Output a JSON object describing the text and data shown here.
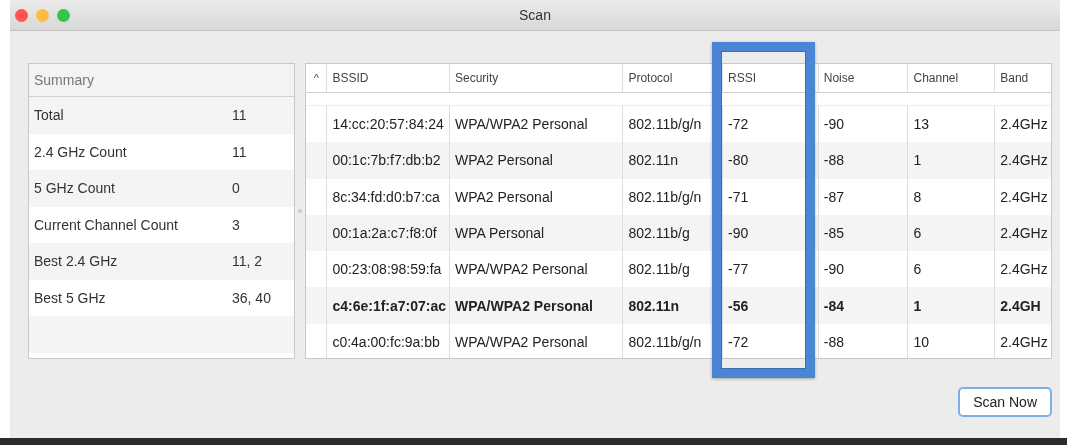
{
  "window": {
    "title": "Scan"
  },
  "summary": {
    "title": "Summary",
    "rows": [
      {
        "label": "Total",
        "value": "11"
      },
      {
        "label": "2.4 GHz Count",
        "value": "11"
      },
      {
        "label": "5 GHz Count",
        "value": "0"
      },
      {
        "label": "Current Channel Count",
        "value": "3"
      },
      {
        "label": "Best 2.4 GHz",
        "value": "11, 2"
      },
      {
        "label": "Best 5 GHz",
        "value": "36, 40"
      }
    ]
  },
  "table": {
    "sort_indicator": "^",
    "columns": [
      "BSSID",
      "Security",
      "Protocol",
      "RSSI",
      "Noise",
      "Channel",
      "Band"
    ],
    "rows": [
      {
        "current": false,
        "cells": [
          "14:cc:20:57:84:24",
          "WPA/WPA2 Personal",
          "802.11b/g/n",
          "-72",
          "-90",
          "13",
          "2.4GHz"
        ]
      },
      {
        "current": false,
        "cells": [
          "00:1c:7b:f7:db:b2",
          "WPA2 Personal",
          "802.11n",
          "-80",
          "-88",
          "1",
          "2.4GHz"
        ]
      },
      {
        "current": false,
        "cells": [
          "8c:34:fd:d0:b7:ca",
          "WPA2 Personal",
          "802.11b/g/n",
          "-71",
          "-87",
          "8",
          "2.4GHz"
        ]
      },
      {
        "current": false,
        "cells": [
          "00:1a:2a:c7:f8:0f",
          "WPA Personal",
          "802.11b/g",
          "-90",
          "-85",
          "6",
          "2.4GHz"
        ]
      },
      {
        "current": false,
        "cells": [
          "00:23:08:98:59:fa",
          "WPA/WPA2 Personal",
          "802.11b/g",
          "-77",
          "-90",
          "6",
          "2.4GHz"
        ]
      },
      {
        "current": true,
        "cells": [
          "c4:6e:1f:a7:07:ac",
          "WPA/WPA2 Personal",
          "802.11n",
          "-56",
          "-84",
          "1",
          "2.4GH"
        ]
      },
      {
        "current": false,
        "cells": [
          "c0:4a:00:fc:9a:bb",
          "WPA/WPA2 Personal",
          "802.11b/g/n",
          "-72",
          "-88",
          "10",
          "2.4GHz"
        ]
      }
    ]
  },
  "buttons": [
    {
      "label": "Scan Now"
    }
  ]
}
